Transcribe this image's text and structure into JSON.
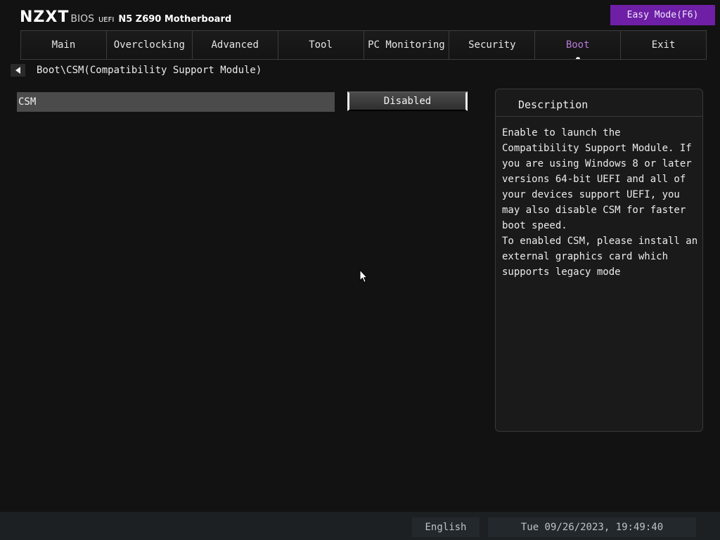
{
  "brand": {
    "logo": "NZXT",
    "bios": "BIOS",
    "uefi": "UEFI",
    "model": "N5 Z690 Motherboard"
  },
  "easy_mode_label": "Easy Mode(F6)",
  "accent_color": "#6e1fa6",
  "active_tab_color": "#b77ad6",
  "nav": {
    "active": "Boot",
    "tabs": [
      {
        "label": "Main"
      },
      {
        "label": "Overclocking"
      },
      {
        "label": "Advanced"
      },
      {
        "label": "Tool"
      },
      {
        "label": "PC Monitoring"
      },
      {
        "label": "Security"
      },
      {
        "label": "Boot"
      },
      {
        "label": "Exit"
      }
    ]
  },
  "breadcrumb": "Boot\\CSM(Compatibility Support Module)",
  "setting": {
    "label": "CSM",
    "value": "Disabled"
  },
  "description": {
    "title": "Description",
    "lines": [
      "Enable to launch the",
      "Compatibility Support Module. If",
      "you are using Windows 8 or later",
      "versions 64-bit UEFI and all of",
      "your devices support UEFI, you",
      "may also disable CSM for faster",
      "boot speed.",
      "To enabled CSM, please install an",
      "external graphics card which",
      "supports legacy mode"
    ]
  },
  "status": {
    "language": "English",
    "datetime": "Tue 09/26/2023, 19:49:40"
  }
}
